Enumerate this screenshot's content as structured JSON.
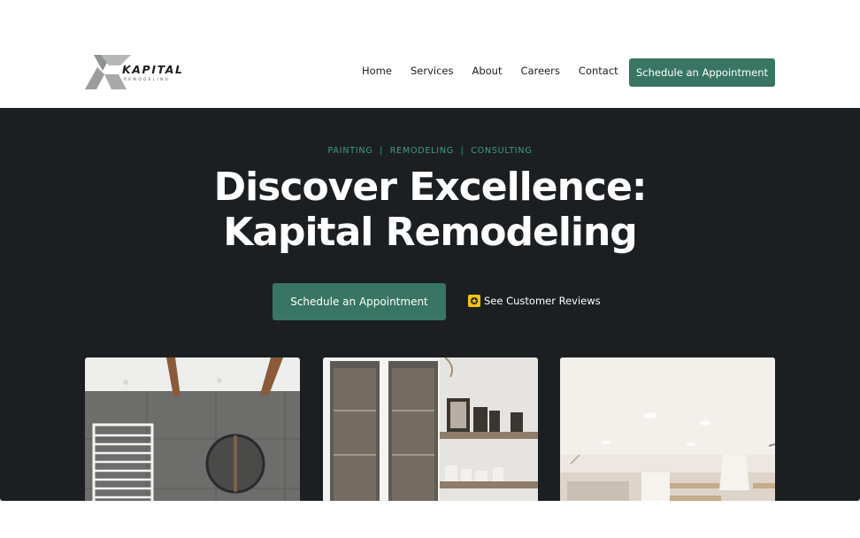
{
  "brand": {
    "name": "KAPITAL",
    "tagline": "REMODELING",
    "colors": {
      "accent": "#387563",
      "eyebrow": "#3e9d7f",
      "hero_bg": "#1c1f22",
      "star": "#f2c318"
    }
  },
  "nav": {
    "items": [
      {
        "label": "Home"
      },
      {
        "label": "Services"
      },
      {
        "label": "About"
      },
      {
        "label": "Careers"
      },
      {
        "label": "Contact"
      }
    ],
    "cta_label": "Schedule an Appointment"
  },
  "hero": {
    "eyebrow": "PAINTING  |  REMODELING  |  CONSULTING",
    "title_line1": "Discover Excellence:",
    "title_line2": "Kapital Remodeling",
    "cta_label": "Schedule an Appointment",
    "reviews_icon": "star-icon",
    "reviews_label": "See Customer Reviews"
  },
  "gallery": [
    {
      "icon": "bathroom-photo"
    },
    {
      "icon": "cabinet-shelves-photo"
    },
    {
      "icon": "kitchen-photo"
    }
  ]
}
